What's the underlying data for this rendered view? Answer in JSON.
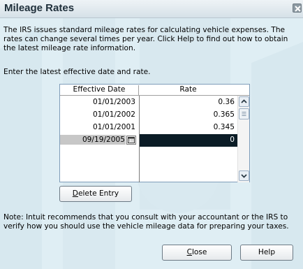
{
  "window": {
    "title": "Mileage Rates"
  },
  "intro": "The IRS issues standard mileage rates for calculating vehicle expenses.  The rates can change several times per year.  Click Help to find out how to obtain the latest mileage rate information.",
  "instruction": "Enter the latest effective date and rate.",
  "table": {
    "columns": [
      "Effective Date",
      "Rate"
    ],
    "rows": [
      {
        "date": "01/01/2003",
        "rate": "0.36"
      },
      {
        "date": "01/01/2002",
        "rate": "0.365"
      },
      {
        "date": "01/01/2001",
        "rate": "0.345"
      }
    ],
    "edit_row": {
      "date": "09/19/2005",
      "rate": "0"
    }
  },
  "buttons": {
    "delete_underlined": "D",
    "delete_rest": "elete Entry",
    "close_underlined": "C",
    "close_rest": "lose",
    "help": "Help"
  },
  "note": "Note: Intuit recommends that you consult with your accountant or the IRS to verify how you should use the vehicle mileage data for preparing your taxes.",
  "icons": {
    "close": "close-icon",
    "calendar": "calendar-icon",
    "scroll_up": "arrow-up-icon",
    "scroll_down": "arrow-down-icon",
    "scroll_thumb": "scroll-thumb-grip-icon"
  },
  "colors": {
    "window_bg": "#dfeef4",
    "selection": "#0b1c26",
    "border": "#7f9db9"
  }
}
